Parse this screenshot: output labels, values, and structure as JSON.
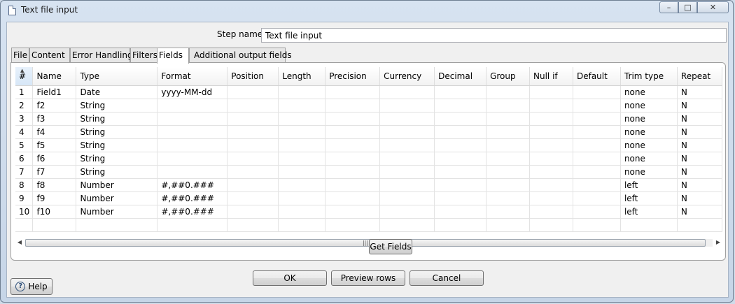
{
  "window": {
    "title": "Text file input"
  },
  "step_name": {
    "label": "Step name",
    "value": "Text file input"
  },
  "tabs": [
    {
      "label": "File"
    },
    {
      "label": "Content"
    },
    {
      "label": "Error Handling"
    },
    {
      "label": "Filters"
    },
    {
      "label": "Fields"
    },
    {
      "label": "Additional output fields"
    }
  ],
  "active_tab": "Fields",
  "grid": {
    "columns": [
      "#",
      "Name",
      "Type",
      "Format",
      "Position",
      "Length",
      "Precision",
      "Currency",
      "Decimal",
      "Group",
      "Null if",
      "Default",
      "Trim type",
      "Repeat"
    ],
    "rows": [
      [
        "1",
        "Field1",
        "Date",
        "yyyy-MM-dd",
        "",
        "",
        "",
        "",
        "",
        "",
        "",
        "",
        "none",
        "N"
      ],
      [
        "2",
        "f2",
        "String",
        "",
        "",
        "",
        "",
        "",
        "",
        "",
        "",
        "",
        "none",
        "N"
      ],
      [
        "3",
        "f3",
        "String",
        "",
        "",
        "",
        "",
        "",
        "",
        "",
        "",
        "",
        "none",
        "N"
      ],
      [
        "4",
        "f4",
        "String",
        "",
        "",
        "",
        "",
        "",
        "",
        "",
        "",
        "",
        "none",
        "N"
      ],
      [
        "5",
        "f5",
        "String",
        "",
        "",
        "",
        "",
        "",
        "",
        "",
        "",
        "",
        "none",
        "N"
      ],
      [
        "6",
        "f6",
        "String",
        "",
        "",
        "",
        "",
        "",
        "",
        "",
        "",
        "",
        "none",
        "N"
      ],
      [
        "7",
        "f7",
        "String",
        "",
        "",
        "",
        "",
        "",
        "",
        "",
        "",
        "",
        "none",
        "N"
      ],
      [
        "8",
        "f8",
        "Number",
        "#,##0.###",
        "",
        "",
        "",
        "",
        "",
        "",
        "",
        "",
        "left",
        "N"
      ],
      [
        "9",
        "f9",
        "Number",
        "#,##0.###",
        "",
        "",
        "",
        "",
        "",
        "",
        "",
        "",
        "left",
        "N"
      ],
      [
        "10",
        "f10",
        "Number",
        "#,##0.###",
        "",
        "",
        "",
        "",
        "",
        "",
        "",
        "",
        "left",
        "N"
      ]
    ]
  },
  "buttons": {
    "get_fields": "Get Fields",
    "ok": "OK",
    "preview_rows": "Preview rows",
    "cancel": "Cancel",
    "help": "Help"
  }
}
